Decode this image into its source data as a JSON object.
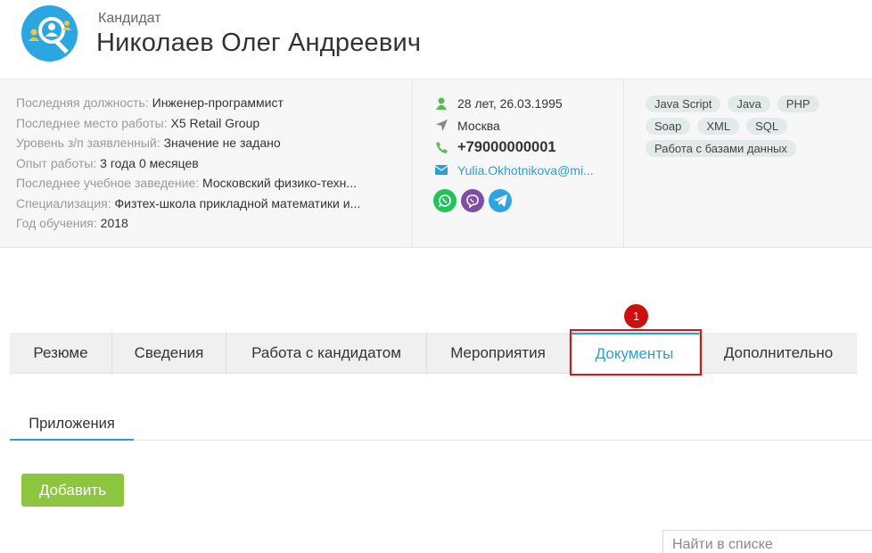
{
  "header": {
    "label": "Кандидат",
    "name": "Николаев Олег Андреевич",
    "avatar_icon": "candidate-search-icon",
    "avatar_color": "#2aa7e0"
  },
  "info": {
    "rows": [
      {
        "key": "Последняя должность:",
        "value": "Инженер-программист"
      },
      {
        "key": "Последнее место работы:",
        "value": "X5 Retail Group"
      },
      {
        "key": "Уровень з/п заявленный:",
        "value": "Значение не задано"
      },
      {
        "key": "Опыт работы:",
        "value": "3 года 0 месяцев"
      },
      {
        "key": "Последнее учебное заведение:",
        "value": "Московский физико-техн..."
      },
      {
        "key": "Специализация:",
        "value": "Физтех-школа прикладной математики и..."
      },
      {
        "key": "Год обучения:",
        "value": "2018"
      }
    ],
    "contacts": {
      "age_birth": "28 лет, 26.03.1995",
      "city": "Москва",
      "phone": "+79000000001",
      "email": "Yulia.Okhotnikova@mi..."
    },
    "messengers": [
      "whatsapp-icon",
      "viber-icon",
      "telegram-icon"
    ],
    "skills": [
      "Java Script",
      "Java",
      "PHP",
      "Soap",
      "XML",
      "SQL",
      "Работа с базами данных"
    ]
  },
  "tabs": [
    {
      "label": "Резюме"
    },
    {
      "label": "Сведения"
    },
    {
      "label": "Работа с кандидатом"
    },
    {
      "label": "Мероприятия"
    },
    {
      "label": "Документы",
      "active": true
    },
    {
      "label": "Дополнительно"
    }
  ],
  "annotation": {
    "number": "1",
    "color": "#cc1010"
  },
  "subtabs": [
    {
      "label": "Приложения"
    }
  ],
  "add_button": {
    "label": "Добавить",
    "color": "#8cc63f"
  },
  "search": {
    "placeholder": "Найти в списке"
  },
  "colors": {
    "accent": "#2a9fd6",
    "tag_bg": "#e3eaea"
  }
}
